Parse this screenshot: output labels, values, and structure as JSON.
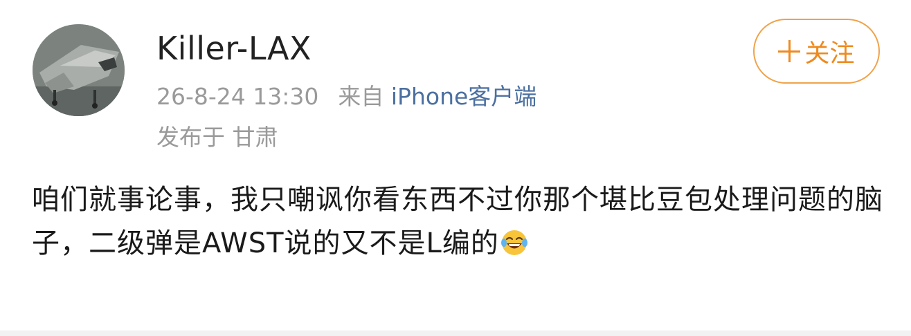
{
  "post": {
    "author": {
      "username": "Killer-LAX",
      "avatar": "avatar-icon"
    },
    "timestamp": "26-8-24 13:30",
    "source_prefix": "来自",
    "source_app": "iPhone客户端",
    "location": "发布于 甘肃",
    "follow_label": "关注",
    "content_text": "咱们就事论事，我只嘲讽你看东西不过你那个堪比豆包处理问题的脑子，二级弹是AWST说的又不是L编的",
    "content_emoji": "laughing-tears-emoji"
  },
  "colors": {
    "accent_orange": "#ee8a1e",
    "link_blue": "#4b6fa0",
    "meta_gray": "#9a9a9a"
  }
}
